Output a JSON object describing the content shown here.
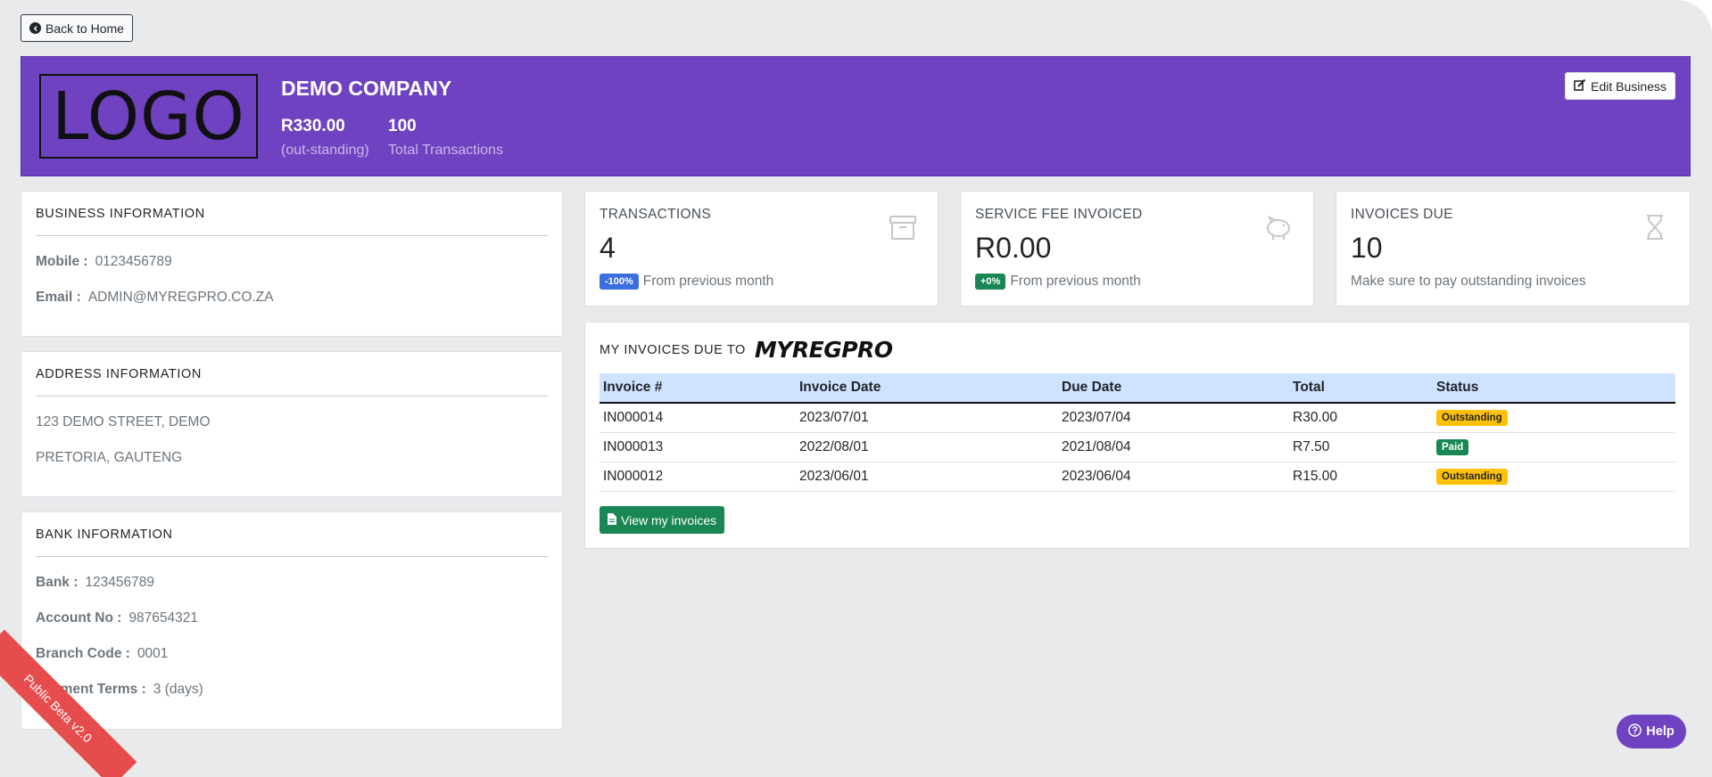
{
  "nav": {
    "back_label": "Back to Home"
  },
  "banner": {
    "logo_text": "LOGO",
    "company_name": "DEMO COMPANY",
    "outstanding_value": "R330.00",
    "outstanding_label": "(out-standing)",
    "transactions_value": "100",
    "transactions_label": "Total Transactions",
    "edit_label": "Edit Business"
  },
  "business_info": {
    "title": "BUSINESS INFORMATION",
    "mobile_label": "Mobile :",
    "mobile_value": "0123456789",
    "email_label": "Email :",
    "email_value": "ADMIN@MYREGPRO.CO.ZA"
  },
  "address_info": {
    "title": "ADDRESS INFORMATION",
    "line1": "123 DEMO STREET, DEMO",
    "line2": "PRETORIA, GAUTENG"
  },
  "bank_info": {
    "title": "BANK INFORMATION",
    "bank_label": "Bank :",
    "bank_value": "123456789",
    "account_label": "Account No :",
    "account_value": "987654321",
    "branch_label": "Branch Code :",
    "branch_value": "0001",
    "terms_label": "Payment Terms :",
    "terms_value": "3 (days)"
  },
  "stats": [
    {
      "title": "TRANSACTIONS",
      "value": "4",
      "pct": "-100%",
      "pct_color": "#3b6fe0",
      "foot": "From previous month",
      "icon": "archive-icon"
    },
    {
      "title": "SERVICE FEE INVOICED",
      "value": "R0.00",
      "pct": "+0%",
      "pct_color": "#198754",
      "foot": "From previous month",
      "icon": "piggy-bank-icon"
    },
    {
      "title": "INVOICES DUE",
      "value": "10",
      "pct": "",
      "foot": "Make sure to pay outstanding invoices",
      "icon": "hourglass-icon"
    }
  ],
  "invoices": {
    "title": "MY INVOICES DUE TO",
    "brand": "MYREGPRO",
    "headers": [
      "Invoice #",
      "Invoice Date",
      "Due Date",
      "Total",
      "Status"
    ],
    "rows": [
      {
        "number": "IN000014",
        "invoice_date": "2023/07/01",
        "due_date": "2023/07/04",
        "total": "R30.00",
        "status": "Outstanding"
      },
      {
        "number": "IN000013",
        "invoice_date": "2022/08/01",
        "due_date": "2021/08/04",
        "total": "R7.50",
        "status": "Paid"
      },
      {
        "number": "IN000012",
        "invoice_date": "2023/06/01",
        "due_date": "2023/06/04",
        "total": "R15.00",
        "status": "Outstanding"
      }
    ],
    "view_label": "View my invoices",
    "status_colors": {
      "Outstanding": "#ffc107",
      "Paid": "#198754"
    }
  },
  "help_label": "Help",
  "ribbon_text": "Public Beta v2.0"
}
